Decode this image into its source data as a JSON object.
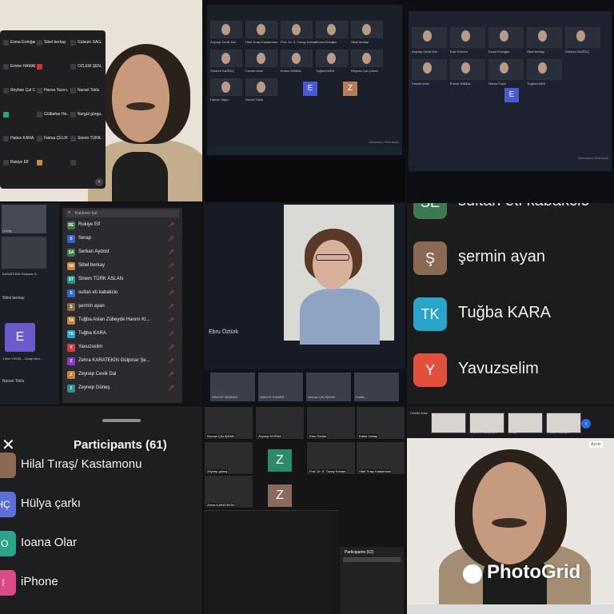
{
  "cell1": {
    "participants": [
      {
        "name": "Esma Erdoğan",
        "color": "#3a3d44"
      },
      {
        "name": "Sibel berkay",
        "color": "#3a3d44"
      },
      {
        "name": "Gülsüm SAĞ...",
        "color": "#3a3d44"
      },
      {
        "name": "Emine HAMAL",
        "color": "#3a3d44"
      },
      {
        "name": "",
        "color": "#c33"
      },
      {
        "name": "ÖZLEM ŞEN...",
        "color": "#3a3d44"
      },
      {
        "name": "Reyhan Çal C...",
        "color": "#3a3d44"
      },
      {
        "name": "Havva Yazıcı...",
        "color": "#3a3d44"
      },
      {
        "name": "Nursel Toklu",
        "color": "#3a3d44"
      },
      {
        "name": "",
        "color": "#2a7"
      },
      {
        "name": "Gülbahar Ho...",
        "color": "#3a3d44"
      },
      {
        "name": "Nurgül gürga...",
        "color": "#3a3d44"
      },
      {
        "name": "Hatice KARA...",
        "color": "#3a3d44"
      },
      {
        "name": "Fatma ÇELİK",
        "color": "#3a3d44"
      },
      {
        "name": "Sinem TÜRK...",
        "color": "#3a3d44"
      },
      {
        "name": "Rukiye Elf",
        "color": "#3a3d44"
      },
      {
        "name": "",
        "color": "#c84"
      },
      {
        "name": "",
        "color": "#3a3d44"
      }
    ]
  },
  "cell2": {
    "names": [
      "Zeynep Cevik Dal",
      "Hilal Tıraş/ Kastamonu",
      "Prof. Dr. S. Tunay Kaman",
      "Esma Erdoğan",
      "Sibel berkay",
      "Gülsüm SAĞDIÇ",
      "Cemile köse",
      "Emine HAMAL",
      "Tuğba KARA",
      "Reyhan Çal Çoban",
      "Hande Yağcı",
      "Nursel Toklu"
    ],
    "tiles": [
      "E",
      "Z"
    ],
    "notice": "Windows'u Etkinleştir"
  },
  "cell3": {
    "names": [
      "Zeynep Cevik Dal",
      "Eda Gökcen",
      "Esma Erdoğan",
      "Sibel berkay",
      "Gülsüm SAĞDIÇ",
      "Cemile köse",
      "Emine HAMAL",
      "Nursel Toklu",
      "Tuğba KARA"
    ],
    "tiles": [
      "E"
    ],
    "notice": "Windows'u Etkinleştir"
  },
  "cell4": {
    "search_placeholder": "Katılımcı bul",
    "left_names": [
      "Ozbay",
      "KARATEKİN Gülpınar Ş...",
      "Sibel berkay",
      "Yıldız YÜCEL - Ozlay Meri...",
      "Nursel Toklu"
    ],
    "left_tile": "E",
    "participants": [
      {
        "initials": "RE",
        "name": "Rukiye Elf",
        "color": "#3d7a52"
      },
      {
        "initials": "S",
        "name": "Serap",
        "color": "#3367c9"
      },
      {
        "initials": "SA",
        "name": "Serkan Aydost",
        "color": "#3d7a52"
      },
      {
        "initials": "SB",
        "name": "Sibel berkay",
        "color": "#c9833a"
      },
      {
        "initials": "ST",
        "name": "Sinem TÜRK ASLAN",
        "color": "#2f8f8f"
      },
      {
        "initials": "S",
        "name": "sultan eti kabakcio",
        "color": "#3367c9"
      },
      {
        "initials": "Ş",
        "name": "şermin ayan",
        "color": "#8a6a4a"
      },
      {
        "initials": "TA",
        "name": "Tuğba Aslan Zübeyde Hanım Kl...",
        "color": "#c9833a"
      },
      {
        "initials": "TK",
        "name": "Tuğba KARA",
        "color": "#2aa5c9"
      },
      {
        "initials": "Y",
        "name": "Yavuzselim",
        "color": "#c94545"
      },
      {
        "initials": "Z",
        "name": "Zehra KARATEKİN Gülpınar Şe...",
        "color": "#8a3ac9"
      },
      {
        "initials": "Z",
        "name": "Zeynep Cevik Dal",
        "color": "#c9833a"
      },
      {
        "initials": "Z",
        "name": "Zeynep Güneş",
        "color": "#2f8f8f"
      }
    ]
  },
  "cell5": {
    "speaker": "Ebru Öztürk",
    "strip_names": [
      "RAHİYE BAŞKAN",
      "RAHİYE KAMER",
      "Nurcan ÇALIŞKAN",
      "Fotöm..."
    ]
  },
  "cell6": {
    "participants": [
      {
        "initials": "SE",
        "name": "sultan eti kabakcio",
        "color": "#3d7a52"
      },
      {
        "initials": "Ş",
        "name": "şermin ayan",
        "color": "#8a6a52"
      },
      {
        "initials": "TK",
        "name": "Tuğba KARA",
        "color": "#2aa5c9"
      },
      {
        "initials": "Y",
        "name": "Yavuzselim",
        "color": "#e0503c"
      }
    ]
  },
  "cell7": {
    "title": "Participants (61)",
    "participants": [
      {
        "initials": "",
        "name": "Hilal Tıraş/ Kastamonu",
        "color": "#8a6a52"
      },
      {
        "initials": "HÇ",
        "name": "Hülya çarkı",
        "color": "#5b6fd9"
      },
      {
        "initials": "IO",
        "name": "Ioana Olar",
        "color": "#2aa58a"
      },
      {
        "initials": "I",
        "name": "iPhone",
        "color": "#d94a86"
      }
    ]
  },
  "cell8": {
    "names": [
      "Nurcan ÇALIŞKAN",
      "Zeynep KIVRAK",
      "Ebru Öztürk",
      "Edebi Ozbay",
      "Zeynep güneş",
      "Prof. Dr. S. Tunay Kaman",
      "Hilal Tıraş/ Kastamonu",
      "Zehra KARATEKİN"
    ],
    "tiles": [
      "Z",
      "Z"
    ],
    "panel_title": "Participants (62)"
  },
  "cell9": {
    "top_names": [
      "Cemile köse",
      "RAHİYE BAŞKAN",
      "eBay...",
      "Hatice Katmak..."
    ],
    "watermark": "PhotoGrid",
    "badge": "Ayrılır"
  }
}
